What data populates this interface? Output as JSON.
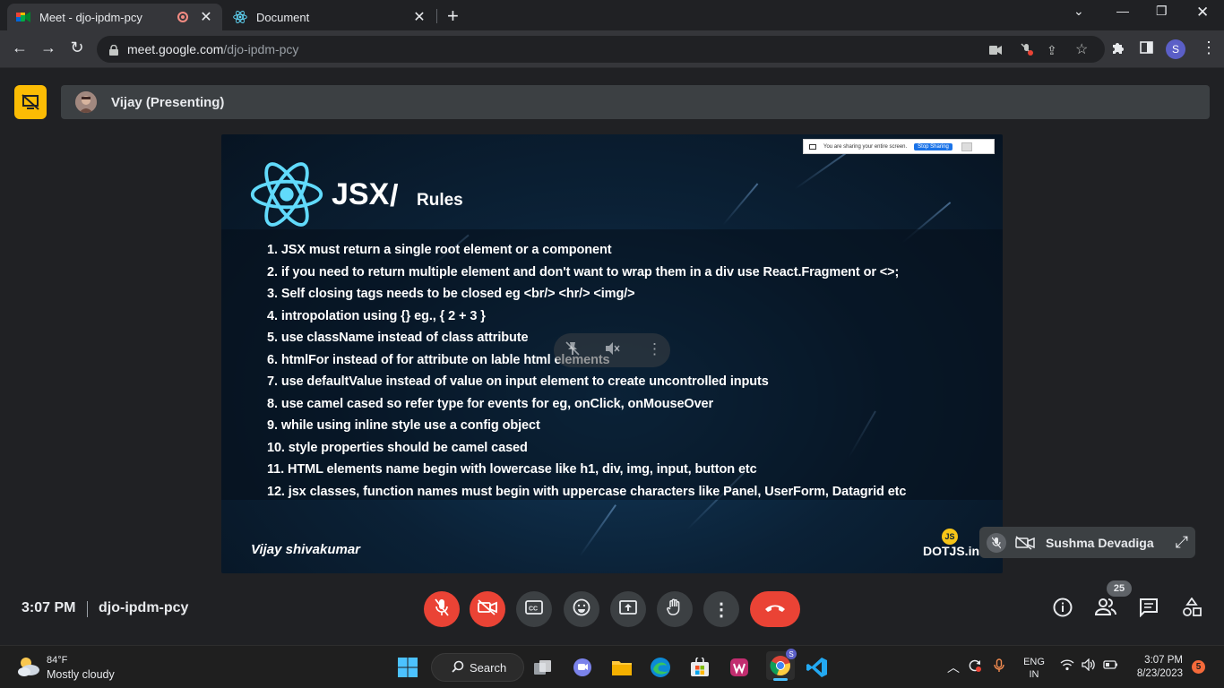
{
  "browser": {
    "tabs": [
      {
        "title": "Meet - djo-ipdm-pcy",
        "active": true,
        "recording": true
      },
      {
        "title": "Document",
        "active": false
      }
    ],
    "url_host": "meet.google.com",
    "url_path": "/djo-ipdm-pcy",
    "profile_initial": "S"
  },
  "meet": {
    "presenter_label": "Vijay (Presenting)",
    "slide": {
      "title": "JSX",
      "slash": "/",
      "subtitle": "Rules",
      "share_notice": "You are sharing your entire screen.",
      "stop_sharing_label": "Stop Sharing",
      "rules": [
        "1. JSX must return a single root element or a component",
        "2. if you need to return multiple element and don't want to wrap them in a div use React.Fragment or <>;",
        "3. Self closing tags needs to be closed eg <br/> <hr/> <img/>",
        "4. intropolation using {} eg.,  { 2 + 3  }",
        "5. use className instead of class attribute",
        "6. htmlFor instead of for attribute on lable html elements",
        "7. use defaultValue instead of value on input element to create uncontrolled inputs",
        "8. use camel cased so refer type for events for eg, onClick, onMouseOver",
        "9. while using inline style use a config object",
        "10. style properties should be camel cased",
        "11. HTML elements name begin with lowercase like h1, div, img, input, button etc",
        "12. jsx classes, function names must begin with uppercase characters like Panel, UserForm, Datagrid etc"
      ],
      "footer_left": "Vijay shivakumar",
      "footer_right": "DOTJS.in",
      "logo_text": "JS"
    },
    "pip_name": "Sushma Devadiga",
    "time": "3:07 PM",
    "separator": "|",
    "meeting_code": "djo-ipdm-pcy",
    "participants_count": "25",
    "accent_end_call": "#ea4335",
    "accent_share_badge": "#fbbc04"
  },
  "taskbar": {
    "weather_temp": "84°F",
    "weather_desc": "Mostly cloudy",
    "search_label": "Search",
    "lang_line1": "ENG",
    "lang_line2": "IN",
    "time": "3:07 PM",
    "date": "8/23/2023",
    "notification_count": "5",
    "chrome_badge": "S"
  }
}
